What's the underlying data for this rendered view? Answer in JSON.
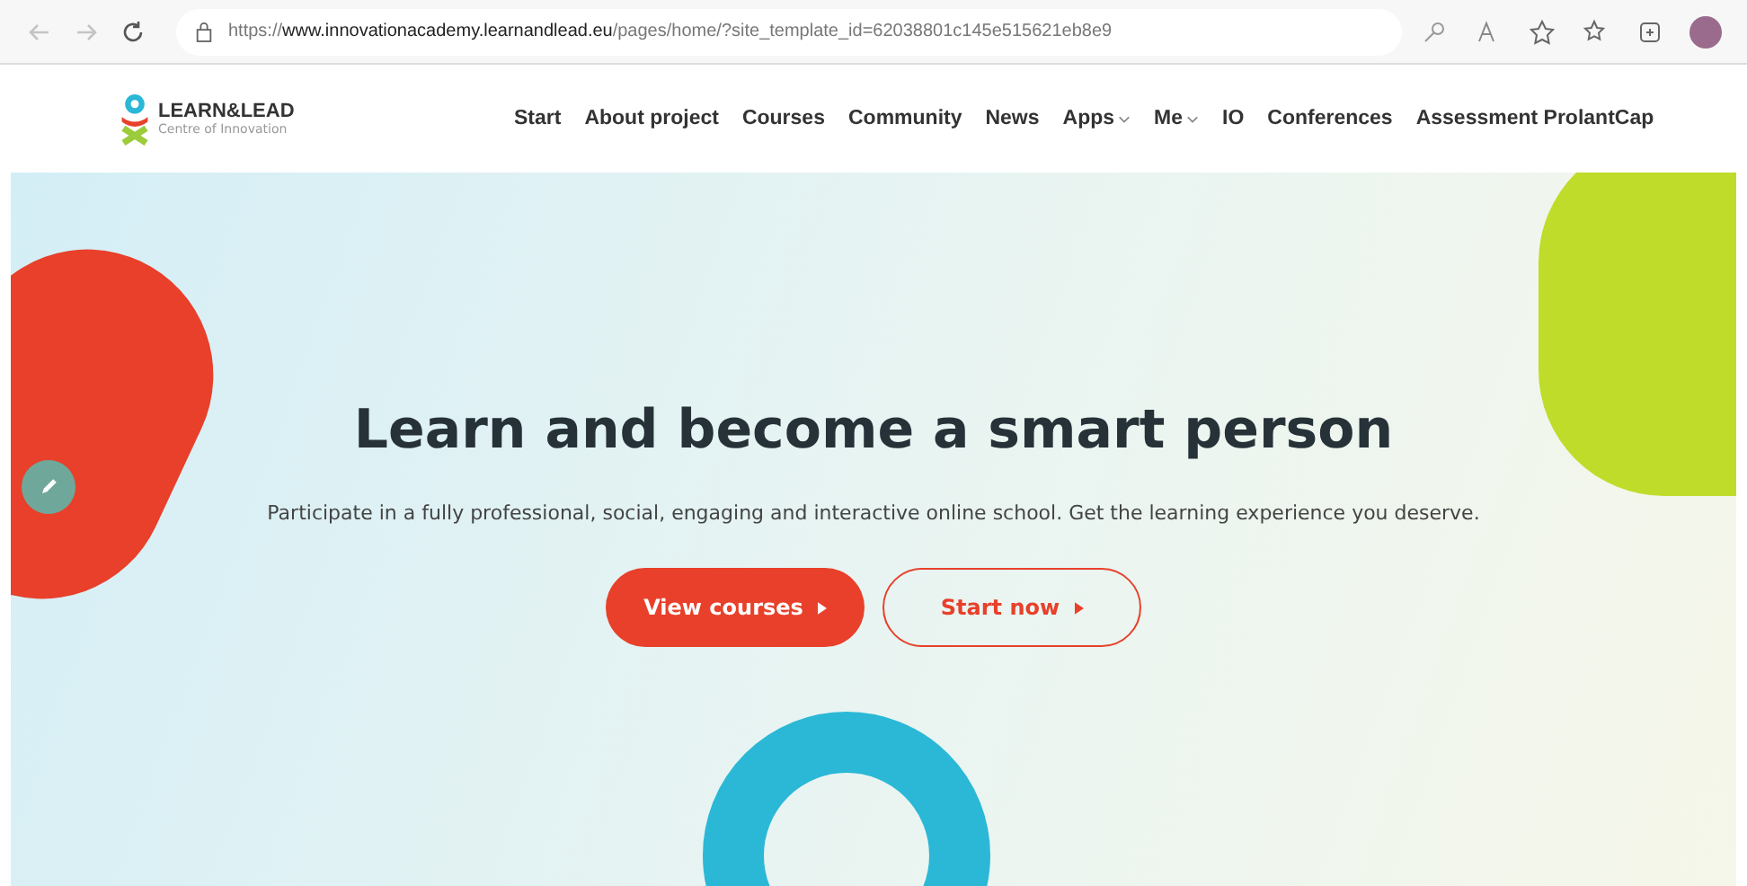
{
  "browser": {
    "url_prefix": "https://",
    "url_host": "www.innovationacademy.learnandlead.eu",
    "url_path": "/pages/home/?site_template_id=62038801c145e515621eb8e9"
  },
  "logo": {
    "name": "LEARN&LEAD",
    "tagline": "Centre of Innovation"
  },
  "nav": [
    {
      "label": "Start",
      "has_menu": false
    },
    {
      "label": "About project",
      "has_menu": false
    },
    {
      "label": "Courses",
      "has_menu": false
    },
    {
      "label": "Community",
      "has_menu": false
    },
    {
      "label": "News",
      "has_menu": false
    },
    {
      "label": "Apps",
      "has_menu": true
    },
    {
      "label": "Me",
      "has_menu": true
    },
    {
      "label": "IO",
      "has_menu": false
    },
    {
      "label": "Conferences",
      "has_menu": false
    },
    {
      "label": "Assessment ProlantCap",
      "has_menu": false
    }
  ],
  "hero": {
    "title": "Learn and become a smart person",
    "subtitle": "Participate in a fully professional, social, engaging and interactive online school. Get the learning experience you deserve.",
    "buttons": [
      {
        "label": "View courses",
        "kind": "primary"
      },
      {
        "label": "Start now",
        "kind": "outline"
      }
    ]
  }
}
